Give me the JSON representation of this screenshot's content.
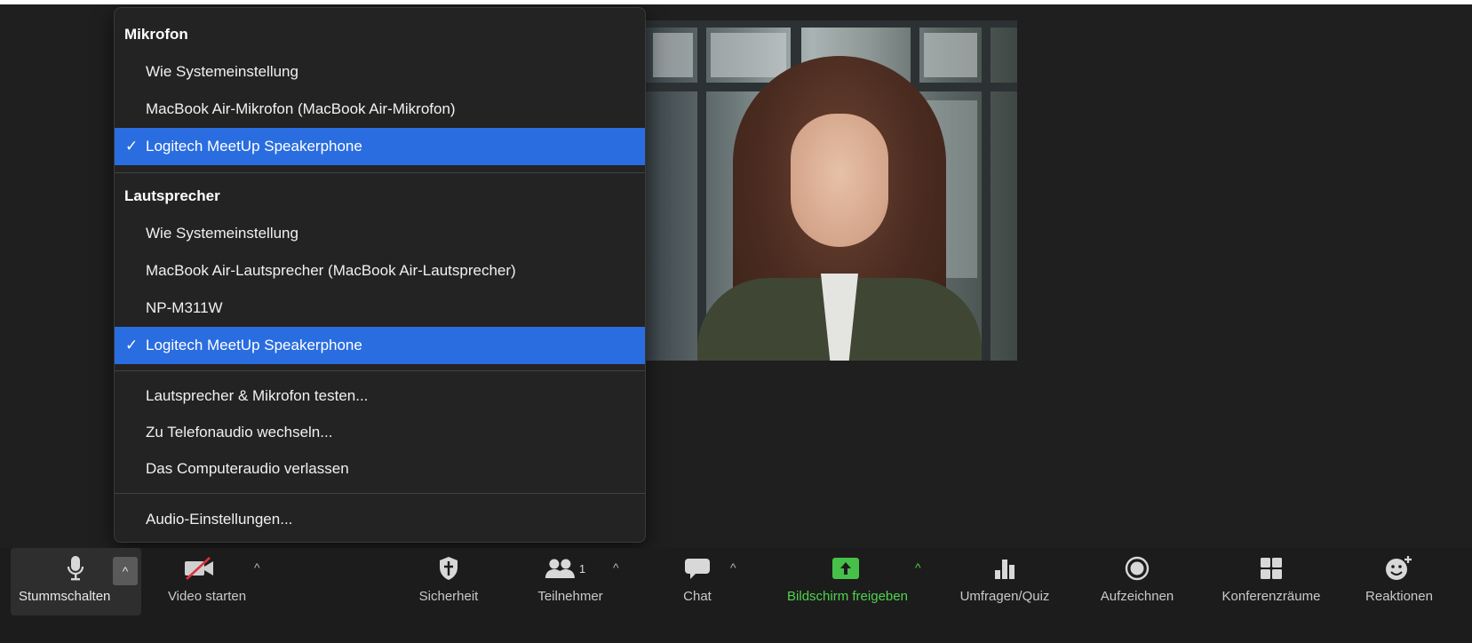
{
  "menu": {
    "mic_header": "Mikrofon",
    "mic_items": [
      {
        "label": "Wie Systemeinstellung",
        "selected": false
      },
      {
        "label": "MacBook Air-Mikrofon (MacBook Air-Mikrofon)",
        "selected": false
      },
      {
        "label": "Logitech MeetUp Speakerphone",
        "selected": true
      }
    ],
    "speaker_header": "Lautsprecher",
    "speaker_items": [
      {
        "label": "Wie Systemeinstellung",
        "selected": false
      },
      {
        "label": "MacBook Air-Lautsprecher (MacBook Air-Lautsprecher)",
        "selected": false
      },
      {
        "label": "NP-M311W",
        "selected": false
      },
      {
        "label": "Logitech MeetUp Speakerphone",
        "selected": true
      }
    ],
    "check_mark": "✓",
    "actions": [
      "Lautsprecher & Mikrofon testen...",
      "Zu Telefonaudio wechseln...",
      "Das Computeraudio verlassen"
    ],
    "settings": "Audio-Einstellungen...",
    "selected_color": "#2a6de0"
  },
  "toolbar": {
    "mute": "Stummschalten",
    "video": "Video starten",
    "security": "Sicherheit",
    "participants": "Teilnehmer",
    "participants_count": "1",
    "chat": "Chat",
    "share": "Bildschirm freigeben",
    "polls": "Umfragen/Quiz",
    "record": "Aufzeichnen",
    "breakout": "Konferenzräume",
    "reactions": "Reaktionen",
    "caret": "^",
    "share_color": "#4fd34f"
  },
  "icons": {
    "mute": "microphone-icon",
    "video": "video-off-icon",
    "security": "shield-icon",
    "participants": "people-icon",
    "chat": "chat-bubble-icon",
    "share": "share-screen-icon",
    "polls": "bar-chart-icon",
    "record": "record-icon",
    "breakout": "grid-icon",
    "reactions": "emoji-add-icon"
  }
}
